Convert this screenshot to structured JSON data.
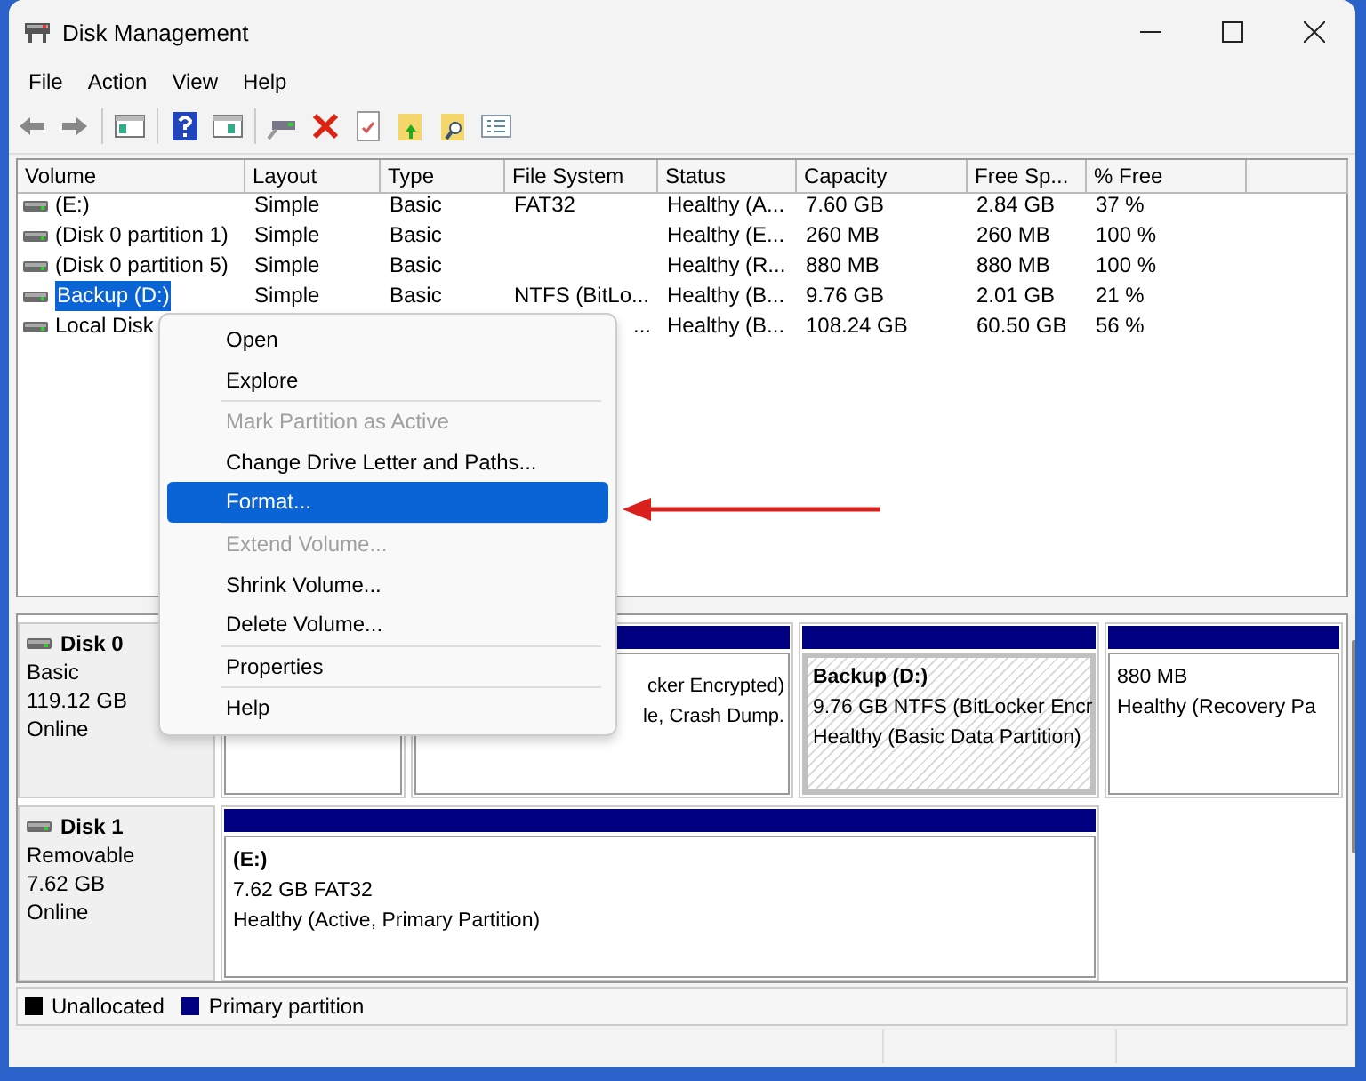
{
  "window": {
    "title": "Disk Management"
  },
  "menu_bar": [
    "File",
    "Action",
    "View",
    "Help"
  ],
  "volume_table": {
    "columns": [
      "Volume",
      "Layout",
      "Type",
      "File System",
      "Status",
      "Capacity",
      "Free Sp...",
      "% Free"
    ],
    "rows": [
      {
        "volume": " (E:)",
        "layout": "Simple",
        "type": "Basic",
        "file_system": "FAT32",
        "status": "Healthy (A...",
        "capacity": "7.60 GB",
        "free_space": "2.84 GB",
        "percent_free": "37 %",
        "selected": false
      },
      {
        "volume": "(Disk 0 partition 1)",
        "layout": "Simple",
        "type": "Basic",
        "status": "Healthy (E...",
        "capacity": "260 MB",
        "free_space": "260 MB",
        "percent_free": "100 %",
        "selected": false
      },
      {
        "volume": "(Disk 0 partition 5)",
        "layout": "Simple",
        "type": "Basic",
        "status": "Healthy (R...",
        "capacity": "880 MB",
        "free_space": "880 MB",
        "percent_free": "100 %",
        "selected": false
      },
      {
        "volume": "Backup (D:)",
        "layout": "Simple",
        "type": "Basic",
        "file_system": "NTFS (BitLo...",
        "status": "Healthy (B...",
        "capacity": "9.76 GB",
        "free_space": "2.01 GB",
        "percent_free": "21 %",
        "selected": true
      },
      {
        "volume": "Local Disk",
        "file_system": "...",
        "status": "Healthy (B...",
        "capacity": "108.24 GB",
        "free_space": "60.50 GB",
        "percent_free": "56 %",
        "selected": false,
        "covered": true
      }
    ]
  },
  "disks": [
    {
      "name": "Disk 0",
      "type": "Basic",
      "size": "119.12 GB",
      "status": "Online",
      "partitions": [
        {
          "selected": false
        },
        {
          "lines": [
            "cker Encrypted)",
            "le, Crash Dump."
          ],
          "selected": false,
          "covered": true
        },
        {
          "title": "Backup  (D:)",
          "lines": [
            "9.76 GB NTFS (BitLocker Encr",
            "Healthy (Basic Data Partition)"
          ],
          "selected": true
        },
        {
          "lines": [
            "880 MB",
            "Healthy (Recovery Pa"
          ],
          "selected": false
        }
      ]
    },
    {
      "name": "Disk 1",
      "type": "Removable",
      "size": "7.62 GB",
      "status": "Online",
      "partitions": [
        {
          "title": "(E:)",
          "lines": [
            "7.62 GB FAT32",
            "Healthy (Active, Primary Partition)"
          ],
          "selected": false
        }
      ]
    }
  ],
  "legend": [
    {
      "label": "Unallocated",
      "color": "#000000"
    },
    {
      "label": "Primary partition",
      "color": "#000080"
    }
  ],
  "context_menu": {
    "items": [
      {
        "kind": "item",
        "label": "Open",
        "disabled": false,
        "selected": false
      },
      {
        "kind": "item",
        "label": "Explore",
        "disabled": false,
        "selected": false
      },
      {
        "kind": "separator"
      },
      {
        "kind": "item",
        "label": "Mark Partition as Active",
        "disabled": true,
        "selected": false
      },
      {
        "kind": "item",
        "label": "Change Drive Letter and Paths...",
        "disabled": false,
        "selected": false
      },
      {
        "kind": "item",
        "label": "Format...",
        "disabled": false,
        "selected": true
      },
      {
        "kind": "separator"
      },
      {
        "kind": "item",
        "label": "Extend Volume...",
        "disabled": true,
        "selected": false
      },
      {
        "kind": "item",
        "label": "Shrink Volume...",
        "disabled": false,
        "selected": false
      },
      {
        "kind": "item",
        "label": "Delete Volume...",
        "disabled": false,
        "selected": false
      },
      {
        "kind": "separator"
      },
      {
        "kind": "item",
        "label": "Properties",
        "disabled": false,
        "selected": false
      },
      {
        "kind": "separator"
      },
      {
        "kind": "item",
        "label": "Help",
        "disabled": false,
        "selected": false
      }
    ]
  }
}
